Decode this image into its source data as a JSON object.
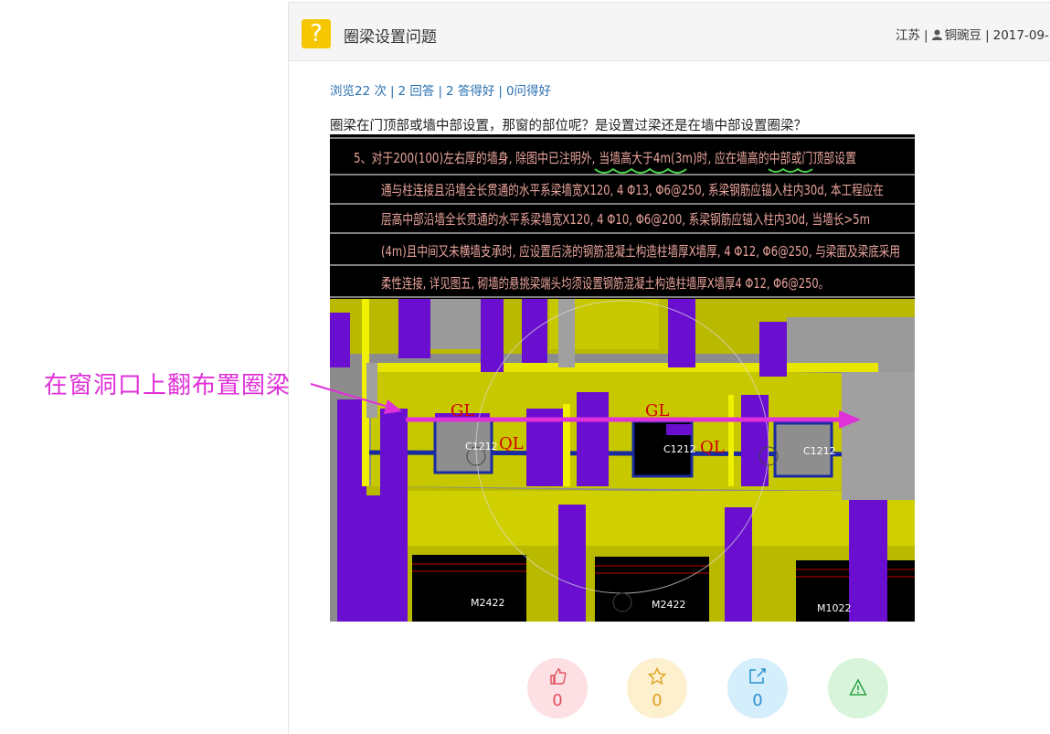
{
  "header": {
    "title": "圈梁设置问题",
    "location": "江苏",
    "username": "铜豌豆",
    "date": "2017-09-"
  },
  "stats": {
    "views": "浏览22 次",
    "answers": "2 回答",
    "good_answers": "2 答得好",
    "helpful": "0问得好"
  },
  "question_text": "圈梁在门顶部或墙中部设置，那窗的部位呢？是设置过梁还是在墙中部设置圈梁？",
  "figure": {
    "note_lines": [
      "5、对于200(100)左右厚的墙身, 除图中已注明外, 当墙高大于4m(3m)时, 应在墙高的中部或门顶部设置",
      "通与柱连接且沿墙全长贯通的水平系梁墙宽X120, 4 Φ13, Φ6@250, 系梁钢筋应锚入柱内30d, 本工程应在",
      "层高中部沿墙全长贯通的水平系梁墙宽X120, 4 Φ10, Φ6@200, 系梁钢筋应锚入柱内30d, 当墙长>5m",
      "(4m)且中间又未横墙支承时, 应设置后浇的钢筋混凝土构造柱墙厚X墙厚, 4 Φ12, Φ6@250, 与梁面及梁底采用",
      "柔性连接, 详见图五, 砌墙的悬挑梁端头均须设置钢筋混凝土构造柱墙厚X墙厚4 Φ12, Φ6@250。"
    ],
    "window_labels": [
      "C1212",
      "C1212",
      "C1212"
    ],
    "door_labels": [
      "M2422",
      "M2422",
      "M1022"
    ],
    "handwritten_marks": [
      "GL",
      "QL",
      "GL",
      "QL"
    ]
  },
  "annotation_text": "在窗洞口上翻布置圈梁",
  "actions": [
    {
      "name": "like",
      "icon": "thumbs-up-icon",
      "count": "0"
    },
    {
      "name": "favorite",
      "icon": "star-icon",
      "count": "0"
    },
    {
      "name": "share",
      "icon": "share-icon",
      "count": "0"
    },
    {
      "name": "report",
      "icon": "warning-icon",
      "count": ""
    }
  ],
  "colors": {
    "accent_link": "#2a6fb0",
    "question_badge": "#f6c700",
    "annotation": "#e030d8",
    "wall_yellow": "#c8c800",
    "column_purple": "#6a0ed0"
  }
}
